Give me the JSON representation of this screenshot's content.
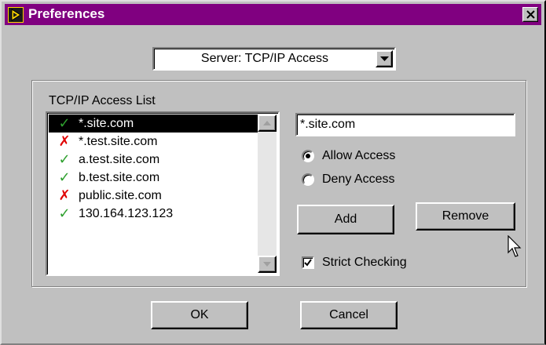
{
  "window": {
    "title": "Preferences",
    "close_glyph": "close-icon"
  },
  "category_select": {
    "value": "Server: TCP/IP Access"
  },
  "access_list": {
    "label": "TCP/IP Access List",
    "items": [
      {
        "host": "*.site.com",
        "status": "allow",
        "icon": "✓",
        "selected": true
      },
      {
        "host": "*.test.site.com",
        "status": "deny",
        "icon": "✗",
        "selected": false
      },
      {
        "host": "a.test.site.com",
        "status": "allow",
        "icon": "✓",
        "selected": false
      },
      {
        "host": "b.test.site.com",
        "status": "allow",
        "icon": "✓",
        "selected": false
      },
      {
        "host": "public.site.com",
        "status": "deny",
        "icon": "✗",
        "selected": false
      },
      {
        "host": "130.164.123.123",
        "status": "allow",
        "icon": "✓",
        "selected": false
      }
    ]
  },
  "host_field": {
    "value": "*.site.com"
  },
  "access_mode": {
    "allow_label": "Allow Access",
    "deny_label": "Deny Access",
    "selected": "allow"
  },
  "buttons": {
    "add": "Add",
    "remove": "Remove",
    "ok": "OK",
    "cancel": "Cancel"
  },
  "strict_checking": {
    "label": "Strict Checking",
    "checked": true
  },
  "colors": {
    "titlebar": "#800080",
    "face": "#c0c0c0",
    "allow_icon": "#2ea02e",
    "deny_icon": "#e00000",
    "selection": "#000000"
  }
}
